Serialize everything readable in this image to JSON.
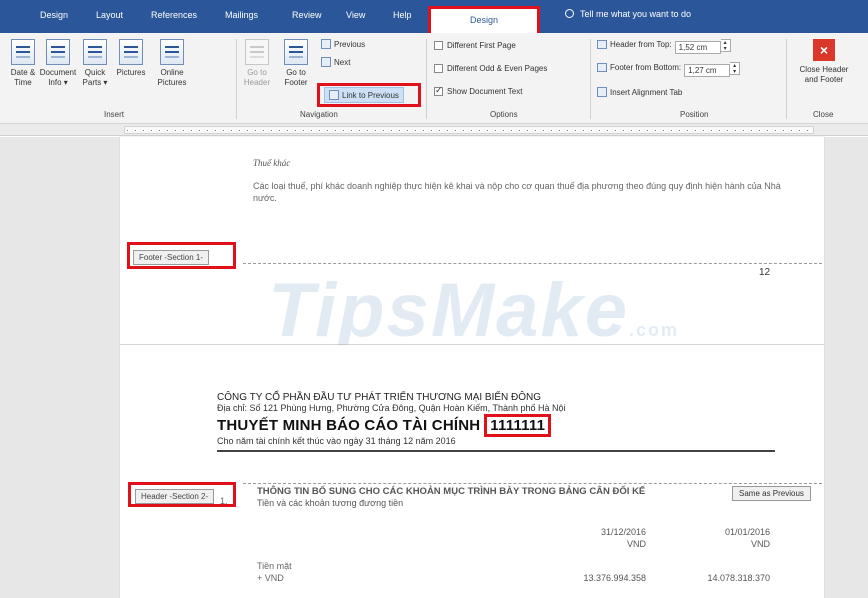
{
  "tabs": [
    "Design",
    "Layout",
    "References",
    "Mailings",
    "Review",
    "View",
    "Help"
  ],
  "active_tab": "Design",
  "tell_me": "Tell me what you want to do",
  "ribbon": {
    "insert": {
      "date_time": [
        "Date &",
        "Time"
      ],
      "document_info": [
        "Document",
        "Info ▾"
      ],
      "quick_parts": [
        "Quick",
        "Parts ▾"
      ],
      "pictures": "Pictures",
      "online_pictures": [
        "Online",
        "Pictures"
      ],
      "label": "Insert"
    },
    "navigation": {
      "go_to_header": [
        "Go to",
        "Header"
      ],
      "go_to_footer": [
        "Go to",
        "Footer"
      ],
      "previous": "Previous",
      "next": "Next",
      "link_to_previous": "Link to Previous",
      "label": "Navigation"
    },
    "options": {
      "different_first_page": "Different First Page",
      "different_odd_even": "Different Odd & Even Pages",
      "show_document_text": "Show Document Text",
      "label": "Options"
    },
    "position": {
      "header_from_top_label": "Header from Top:",
      "header_from_top_value": "1,52 cm",
      "footer_from_bottom_label": "Footer from Bottom:",
      "footer_from_bottom_value": "1,27 cm",
      "insert_alignment_tab": "Insert Alignment Tab",
      "label": "Position"
    },
    "close": {
      "close_header_footer": [
        "Close Header",
        "and Footer"
      ],
      "label": "Close"
    }
  },
  "page1": {
    "heading": "Thuế khác",
    "body": "Các loại thuế, phí khác doanh nghiệp thực hiện kê khai và nộp cho cơ quan thuế địa phương theo đúng quy định hiện hành của Nhà nước.",
    "footer_tag": "Footer -Section 1-",
    "page_number": "12"
  },
  "watermark": {
    "main": "TipsMake",
    "suffix": ".com"
  },
  "page2": {
    "company": "CÔNG TY CỔ PHẦN ĐẦU TƯ PHÁT TRIỂN THƯƠNG MẠI BIỂN ĐÔNG",
    "address": "Địa chỉ: Số 121 Phùng Hưng, Phường Cửa Đông, Quận Hoàn Kiếm, Thành phố Hà Nội",
    "title": "THUYẾT MINH BÁO CÁO TÀI CHÍNH",
    "title_number": "1111111",
    "subtitle": "Cho năm tài chính kết thúc vào ngày 31 tháng 12 năm 2016",
    "header_tag": "Header -Section 2-",
    "same_as_previous": "Same as Previous",
    "section_heading": "THÔNG TIN BỔ SUNG CHO CÁC KHOẢN MỤC TRÌNH BÀY TRONG BẢNG CÂN ĐỐI KẾ",
    "section_number": "1.",
    "section_sub": "Tiền và các khoản tương đương tiền",
    "col1_date": "31/12/2016",
    "col1_unit": "VND",
    "col2_date": "01/01/2016",
    "col2_unit": "VND",
    "row_label": "Tiền mặt",
    "row_sub_label": "+ VND",
    "row_val1": "13.376.994.358",
    "row_val2": "14.078.318.370"
  }
}
